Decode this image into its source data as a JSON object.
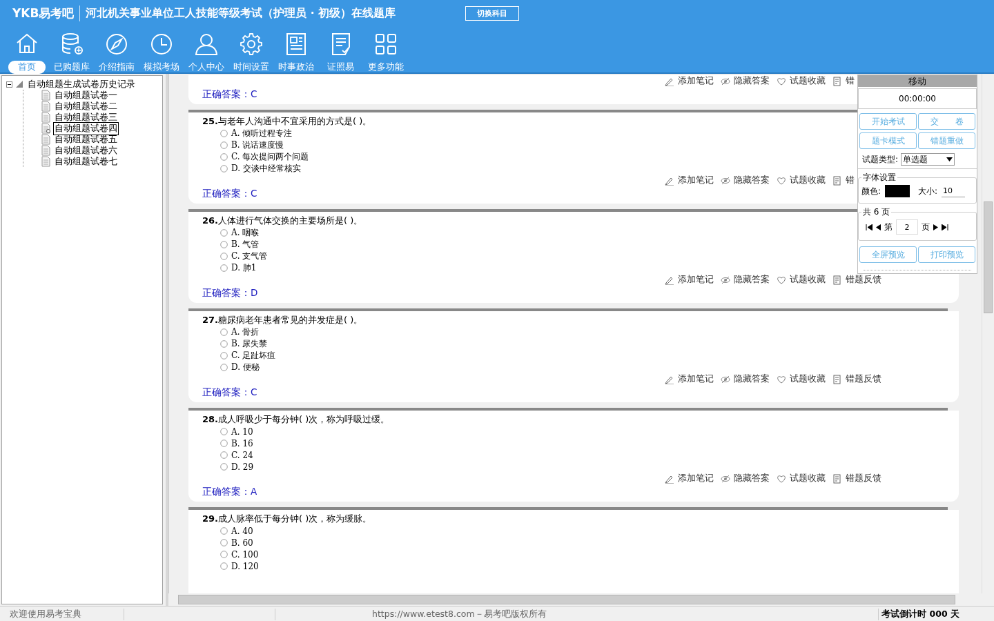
{
  "header": {
    "logo": "YKB易考吧",
    "title": "河北机关事业单位工人技能等级考试（护理员 · 初级）在线题库",
    "switch_button": "切换科目"
  },
  "nav": [
    {
      "kind": "home",
      "label": "首页",
      "selected": true
    },
    {
      "kind": "database",
      "label": "已购题库",
      "selected": false
    },
    {
      "kind": "compass",
      "label": "介绍指南",
      "selected": false
    },
    {
      "kind": "clock",
      "label": "模拟考场",
      "selected": false
    },
    {
      "kind": "user",
      "label": "个人中心",
      "selected": false
    },
    {
      "kind": "gear",
      "label": "时间设置",
      "selected": false
    },
    {
      "kind": "news",
      "label": "时事政治",
      "selected": false
    },
    {
      "kind": "list",
      "label": "证照易",
      "selected": false
    },
    {
      "kind": "grid",
      "label": "更多功能",
      "selected": false
    }
  ],
  "tree": {
    "label": "自动组题生成试卷历史记录",
    "expanded": true,
    "children": [
      {
        "label": "自动组题试卷一",
        "selected": false
      },
      {
        "label": "自动组题试卷二",
        "selected": false
      },
      {
        "label": "自动组题试卷三",
        "selected": false
      },
      {
        "label": "自动组题试卷四",
        "selected": true
      },
      {
        "label": "自动组题试卷五",
        "selected": false
      },
      {
        "label": "自动组题试卷六",
        "selected": false
      },
      {
        "label": "自动组题试卷七",
        "selected": false
      }
    ]
  },
  "questions": [
    {
      "actions": [
        {
          "kind": "note",
          "label": "添加笔记"
        },
        {
          "kind": "hide",
          "label": "隐藏答案"
        },
        {
          "kind": "favorite",
          "label": "试题收藏"
        },
        {
          "kind": "report",
          "label": "错"
        }
      ],
      "answer": "正确答案：C"
    },
    {
      "number": "25.",
      "question": "与老年人沟通中不宜采用的方式是( )。",
      "options": [
        {
          "label": "A. 倾听过程专注",
          "selected": false
        },
        {
          "label": "B. 说话速度慢",
          "selected": false
        },
        {
          "label": "C. 每次提问两个问题",
          "selected": false
        },
        {
          "label": "D. 交谈中经常核实",
          "selected": false
        }
      ],
      "actions": [
        {
          "kind": "note",
          "label": "添加笔记"
        },
        {
          "kind": "hide",
          "label": "隐藏答案"
        },
        {
          "kind": "favorite",
          "label": "试题收藏"
        },
        {
          "kind": "report",
          "label": "错"
        }
      ],
      "answer": "正确答案：C"
    },
    {
      "number": "26.",
      "question": "人体进行气体交换的主要场所是( )。",
      "options": [
        {
          "label": "A. 咽喉",
          "selected": false
        },
        {
          "label": "B. 气管",
          "selected": false
        },
        {
          "label": "C. 支气管",
          "selected": false
        },
        {
          "label": "D. 肺1",
          "selected": false
        }
      ],
      "actions": [
        {
          "kind": "note",
          "label": "添加笔记"
        },
        {
          "kind": "hide",
          "label": "隐藏答案"
        },
        {
          "kind": "favorite",
          "label": "试题收藏"
        },
        {
          "kind": "report",
          "label": "错题反馈"
        }
      ],
      "answer": "正确答案：D"
    },
    {
      "number": "27.",
      "question": "糖尿病老年患者常见的并发症是( )。",
      "options": [
        {
          "label": "A. 骨折",
          "selected": false
        },
        {
          "label": "B. 尿失禁",
          "selected": false
        },
        {
          "label": "C. 足趾坏疽",
          "selected": false
        },
        {
          "label": "D. 便秘",
          "selected": false
        }
      ],
      "actions": [
        {
          "kind": "note",
          "label": "添加笔记"
        },
        {
          "kind": "hide",
          "label": "隐藏答案"
        },
        {
          "kind": "favorite",
          "label": "试题收藏"
        },
        {
          "kind": "report",
          "label": "错题反馈"
        }
      ],
      "answer": "正确答案：C"
    },
    {
      "number": "28.",
      "question": "成人呼吸少于每分钟( )次，称为呼吸过缓。",
      "options": [
        {
          "label": "A. 10",
          "selected": false
        },
        {
          "label": "B. 16",
          "selected": false
        },
        {
          "label": "C. 24",
          "selected": false
        },
        {
          "label": "D. 29",
          "selected": false
        }
      ],
      "actions": [
        {
          "kind": "note",
          "label": "添加笔记"
        },
        {
          "kind": "hide",
          "label": "隐藏答案"
        },
        {
          "kind": "favorite",
          "label": "试题收藏"
        },
        {
          "kind": "report",
          "label": "错题反馈"
        }
      ],
      "answer": "正确答案：A"
    },
    {
      "number": "29.",
      "question": "成人脉率低于每分钟( )次，称为缓脉。",
      "options": [
        {
          "label": "A. 40",
          "selected": false
        },
        {
          "label": "B. 60",
          "selected": false
        },
        {
          "label": "C. 100",
          "selected": false
        },
        {
          "label": "D. 120",
          "selected": false
        }
      ]
    }
  ],
  "panel": {
    "title": "移动",
    "timer": "00:00:00",
    "buttons": [
      "开始考试",
      "交　　卷",
      "题卡模式",
      "错题重做"
    ],
    "type_label": "试题类型:",
    "type_value": "单选题",
    "font_legend": "字体设置",
    "color_label": "颜色:",
    "color": "#000000",
    "size_label": "大小:",
    "size": "10",
    "pages_legend": "共 6 页",
    "page_prefix": "第",
    "page": "2",
    "page_suffix": "页",
    "bottom_buttons": [
      "全屏预览",
      "打印预览"
    ]
  },
  "status_bar": {
    "welcome": "欢迎使用易考宝典",
    "copyright": "https://www.etest8.com－易考吧版权所有",
    "countdown": "考试倒计时 000 天"
  }
}
